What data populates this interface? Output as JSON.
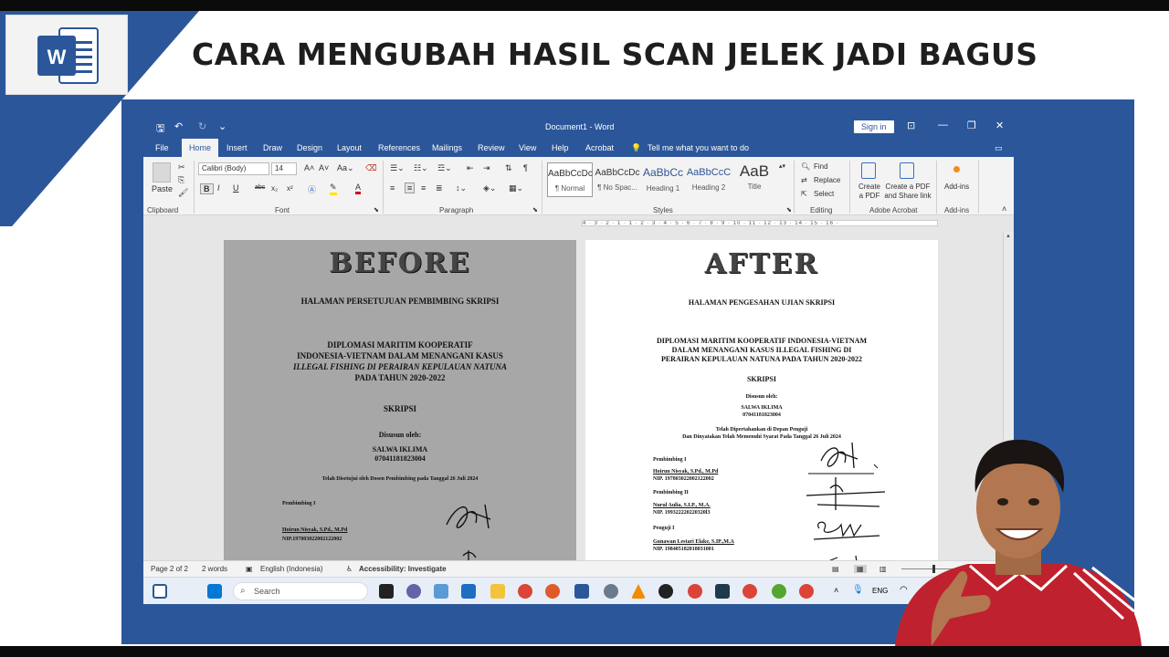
{
  "thumbnail": {
    "title": "CARA MENGUBAH HASIL SCAN JELEK JADI BAGUS",
    "logo_letter": "W",
    "colors": {
      "word_blue": "#2b579a",
      "accent_red": "#c0212e"
    }
  },
  "window": {
    "title": "Document1 - Word",
    "sign_in": "Sign in",
    "quick_access_icons": [
      "save-icon",
      "undo-icon",
      "redo-icon",
      "customize-icon"
    ],
    "controls": [
      "ribbon-display-icon",
      "minimize-icon",
      "restore-icon",
      "close-icon"
    ]
  },
  "tabs": [
    "File",
    "Home",
    "Insert",
    "Draw",
    "Design",
    "Layout",
    "References",
    "Mailings",
    "Review",
    "View",
    "Help",
    "Acrobat"
  ],
  "active_tab": "Home",
  "tell_me": "Tell me what you want to do",
  "ribbon": {
    "clipboard": {
      "paste": "Paste",
      "label": "Clipboard"
    },
    "font": {
      "name": "Calibri (Body)",
      "size": "14",
      "label": "Font",
      "buttons": [
        "B",
        "I",
        "U",
        "abc",
        "x₂",
        "x²",
        "A",
        "A"
      ]
    },
    "paragraph": {
      "label": "Paragraph",
      "pilcrow": "¶"
    },
    "styles": {
      "label": "Styles",
      "items": [
        {
          "sample": "AaBbCcDc",
          "name": "¶ Normal"
        },
        {
          "sample": "AaBbCcDc",
          "name": "¶ No Spac..."
        },
        {
          "sample": "AaBbCc",
          "name": "Heading 1"
        },
        {
          "sample": "AaBbCcC",
          "name": "Heading 2"
        },
        {
          "sample": "AaB",
          "name": "Title"
        }
      ]
    },
    "editing": {
      "label": "Editing",
      "find": "Find",
      "replace": "Replace",
      "select": "Select"
    },
    "acrobat": {
      "label": "Adobe Acrobat",
      "create_pdf": "Create a PDF",
      "create_share": "Create a PDF and Share link"
    },
    "addins": {
      "label": "Add-ins",
      "button": "Add-ins"
    }
  },
  "ruler_text": "4 · 3 · 2 · 1 · 1 · 2 · 3 · 4 · 5 · 6 · 7 · 8 · 9 · 10 · 11 · 12 · 13 · 14 · 15 · 16 ·",
  "before_page": {
    "heading": "BEFORE",
    "title": "HALAMAN PERSETUJUAN PEMBIMBING SKRIPSI",
    "thesis_lines": [
      "DIPLOMASI MARITIM KOOPERATIF",
      "INDONESIA-VIETNAM DALAM MENANGANI KASUS",
      "ILLEGAL FISHING DI PERAIRAN KEPULAUAN NATUNA",
      "PADA TAHUN 2020-2022"
    ],
    "skripsi": "SKRIPSI",
    "disusun": "Disusun oleh:",
    "author": "SALWA IKLIMA",
    "nim": "07041181823004",
    "approved": "Telah Disetujui oleh Dosen Pembimbing pada Tanggal 26 Juli 2024",
    "pembimbing_label": "Pembimbing I",
    "pembimbing_name": "Hoirun Nisyak, S.Pd., M.Pd",
    "pembimbing_nip": "NIP.197803022002122002"
  },
  "after_page": {
    "heading": "AFTER",
    "title": "HALAMAN  PENGESAHAN UJIAN SKRIPSI",
    "thesis_lines": [
      "DIPLOMASI MARITIM KOOPERATIF INDONESIA-VIETNAM",
      "DALAM MENANGANI KASUS ILLEGAL FISHING DI",
      "PERAIRAN KEPULAUAN NATUNA PADA TAHUN 2020-2022"
    ],
    "skripsi": "SKRIPSI",
    "disusun": "Disusun oleh:",
    "author": "SALWA IKLIMA",
    "nim": "07041181823004",
    "defended_1": "Telah Dipertahankan di Depan Penguji",
    "defended_2": "Dan Dinyatakan Telah Memenuhi Syarat Pada Tanggal 26 Juli 2024",
    "signers": [
      {
        "role": "Pembimbing I",
        "name": "Hoirun Nisyak, S.Pd., M.Pd",
        "nip": "NIP. 197803022002122002"
      },
      {
        "role": "Pembimbing II",
        "name": "Nurul Aulia, S.I.P., M.A.",
        "nip": "NIP. 199322220220320l3"
      },
      {
        "role": "Penguji I",
        "name": "Gunawan Lestari Elake, S.IP.,M.A",
        "nip": "NIP. 198405182018031001"
      }
    ]
  },
  "status": {
    "page": "Page 2 of 2",
    "words": "2 words",
    "language": "English (Indonesia)",
    "accessibility": "Accessibility: Investigate"
  },
  "taskbar": {
    "search": "Search",
    "lang": "ENG"
  }
}
